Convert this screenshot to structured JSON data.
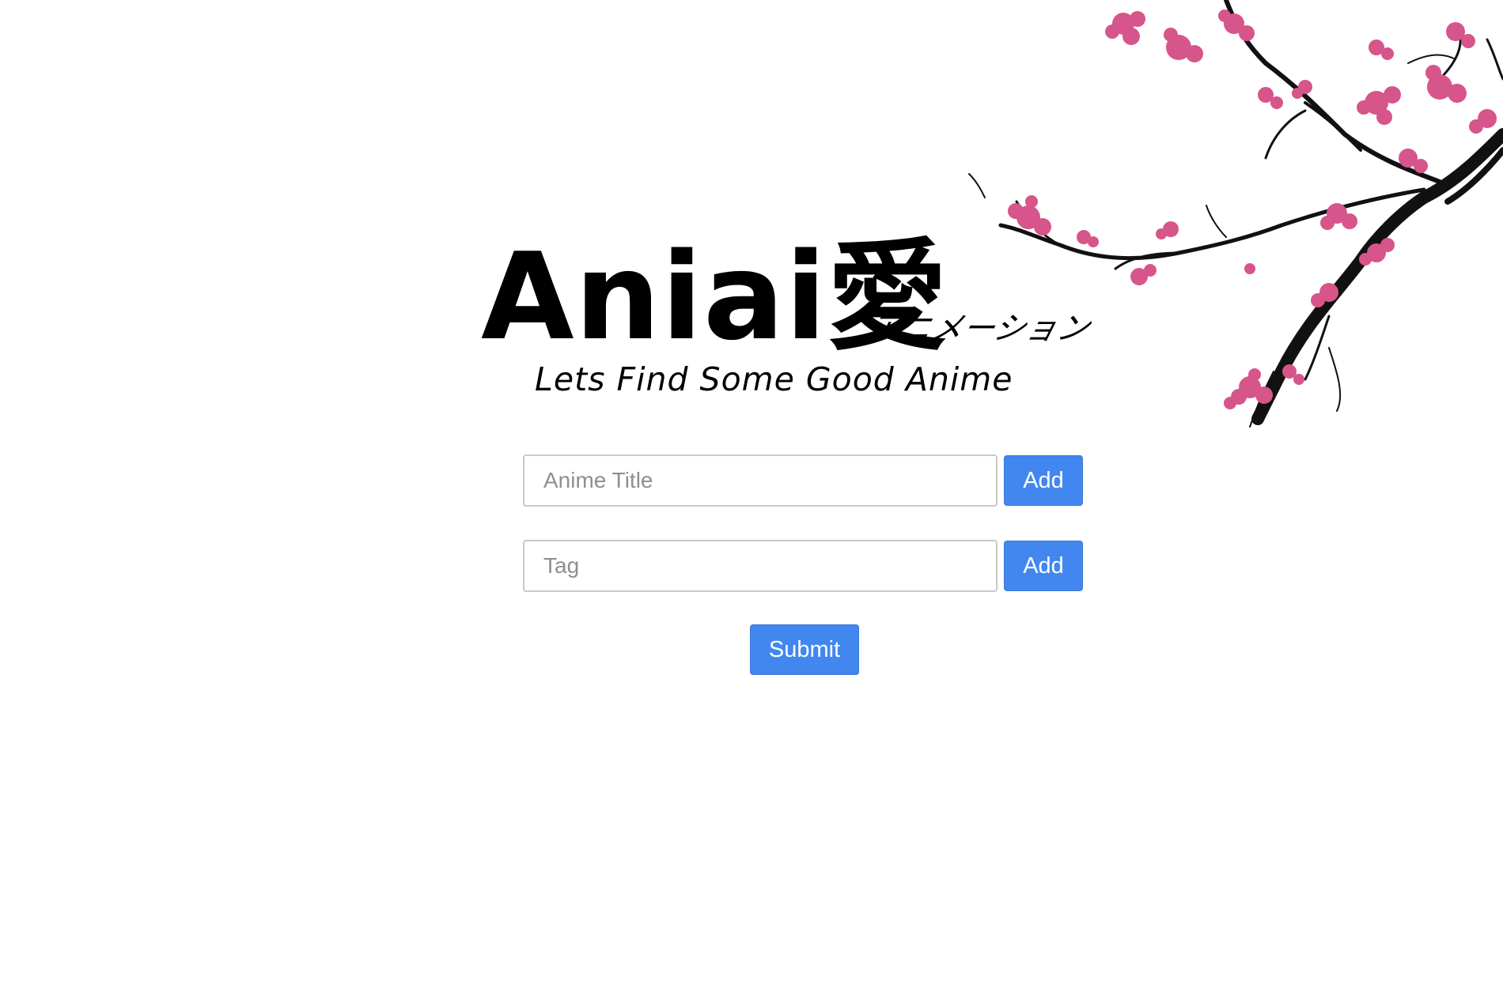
{
  "logo": {
    "main": "Aniai愛",
    "kana": "アニメーション",
    "tagline": "Lets Find Some Good Anime"
  },
  "form": {
    "title_input": {
      "placeholder": "Anime Title",
      "value": ""
    },
    "title_add_label": "Add",
    "tag_input": {
      "placeholder": "Tag",
      "value": ""
    },
    "tag_add_label": "Add",
    "submit_label": "Submit"
  },
  "colors": {
    "button": "#4287ef",
    "blossom": "#d6558a",
    "branch": "#111111"
  },
  "decoration": {
    "icon": "cherry-blossom-branch"
  }
}
